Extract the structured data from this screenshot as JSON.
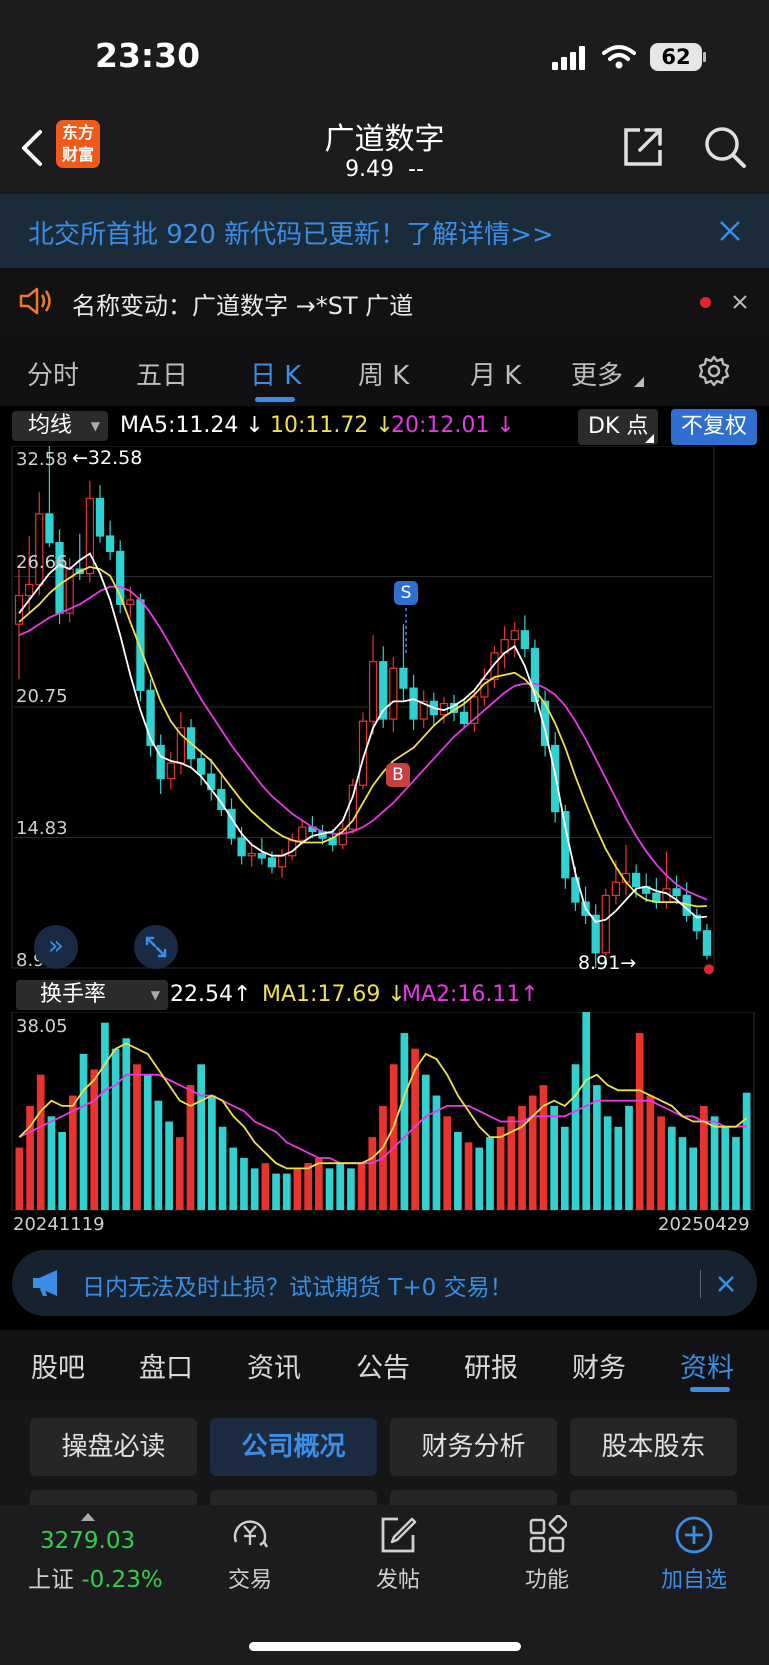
{
  "status": {
    "time": "23:30",
    "battery": "62"
  },
  "header": {
    "logo_line1": "东方",
    "logo_line2": "财富",
    "stock_name": "广道数字",
    "price": "9.49",
    "change": "--"
  },
  "banner": {
    "text": "北交所首批 920 新代码已更新！了解详情>>"
  },
  "notice": {
    "text": "名称变动：广道数字 →*ST 广道"
  },
  "tabs": [
    "分时",
    "五日",
    "日 K",
    "周 K",
    "月 K",
    "更多"
  ],
  "active_tab": "日 K",
  "indicator_bar": {
    "selector": "均线",
    "ma5": "MA5:11.24",
    "ma10": "10:11.72",
    "ma20": "20:12.01",
    "dk": "DK 点",
    "adjust": "不复权",
    "signal_s": "S",
    "signal_b": "B"
  },
  "sub_indicator": {
    "selector": "换手率",
    "value": "22.54",
    "ma1": "MA1:17.69",
    "ma2": "MA2:16.11"
  },
  "colors": {
    "up": "#e8332f",
    "down": "#2fd1d1",
    "ma5": "#ffffff",
    "ma10": "#f0e14b",
    "ma20": "#e63ae6",
    "accent": "#3a8ee6",
    "brand": "#f25a19"
  },
  "chart_data": [
    {
      "type": "candlestick",
      "y_axis_labels": [
        "32.58",
        "26.66",
        "20.75",
        "14.83",
        "8.91"
      ],
      "annotations": {
        "max": "←32.58",
        "min": "8.91→"
      },
      "ylim": [
        8.91,
        32.58
      ],
      "candles": [
        [
          24.5,
          27.0,
          22.0,
          25.8
        ],
        [
          25.8,
          28.5,
          25.0,
          26.3
        ],
        [
          26.3,
          30.5,
          25.8,
          29.5
        ],
        [
          29.5,
          32.58,
          28.0,
          28.2
        ],
        [
          28.2,
          28.8,
          24.5,
          25.0
        ],
        [
          25.0,
          27.5,
          24.6,
          27.0
        ],
        [
          27.0,
          28.6,
          26.5,
          26.8
        ],
        [
          26.8,
          31.0,
          26.4,
          30.2
        ],
        [
          30.2,
          30.8,
          28.2,
          28.5
        ],
        [
          28.5,
          29.2,
          27.4,
          27.8
        ],
        [
          27.8,
          28.3,
          25.0,
          25.4
        ],
        [
          25.4,
          26.2,
          24.8,
          25.6
        ],
        [
          25.6,
          25.9,
          21.0,
          21.5
        ],
        [
          21.5,
          22.0,
          18.5,
          19.0
        ],
        [
          19.0,
          19.5,
          16.8,
          17.5
        ],
        [
          17.5,
          18.7,
          17.0,
          18.2
        ],
        [
          18.2,
          20.5,
          17.7,
          19.8
        ],
        [
          19.8,
          20.2,
          18.0,
          18.4
        ],
        [
          18.4,
          18.8,
          17.2,
          17.7
        ],
        [
          17.7,
          18.4,
          16.5,
          17.0
        ],
        [
          17.0,
          17.6,
          15.8,
          16.1
        ],
        [
          16.1,
          16.6,
          14.5,
          14.8
        ],
        [
          14.8,
          15.3,
          13.6,
          14.0
        ],
        [
          14.0,
          14.6,
          13.5,
          14.1
        ],
        [
          14.1,
          14.8,
          13.6,
          13.9
        ],
        [
          13.9,
          14.2,
          13.2,
          13.5
        ],
        [
          13.5,
          14.3,
          13.0,
          14.0
        ],
        [
          14.0,
          15.0,
          13.8,
          14.7
        ],
        [
          14.7,
          15.6,
          14.5,
          15.3
        ],
        [
          15.3,
          15.8,
          14.8,
          15.1
        ],
        [
          15.1,
          15.4,
          14.5,
          14.8
        ],
        [
          14.8,
          15.2,
          14.2,
          14.5
        ],
        [
          14.5,
          15.5,
          14.3,
          15.2
        ],
        [
          15.2,
          17.5,
          15.0,
          17.2
        ],
        [
          17.2,
          20.5,
          17.0,
          20.1
        ],
        [
          20.1,
          24.0,
          19.5,
          22.8
        ],
        [
          22.8,
          23.5,
          19.8,
          20.2
        ],
        [
          20.2,
          23.0,
          19.6,
          22.5
        ],
        [
          22.5,
          24.5,
          21.0,
          21.6
        ],
        [
          21.6,
          22.2,
          19.7,
          20.2
        ],
        [
          20.2,
          21.5,
          19.8,
          21.0
        ],
        [
          21.0,
          21.4,
          19.9,
          20.4
        ],
        [
          20.4,
          21.2,
          20.0,
          20.9
        ],
        [
          20.9,
          21.3,
          20.1,
          20.5
        ],
        [
          20.5,
          21.1,
          19.8,
          20.0
        ],
        [
          20.0,
          21.5,
          19.6,
          21.2
        ],
        [
          21.2,
          22.5,
          20.8,
          22.0
        ],
        [
          22.0,
          23.5,
          21.6,
          23.2
        ],
        [
          23.2,
          24.4,
          22.5,
          23.8
        ],
        [
          23.8,
          24.6,
          23.0,
          24.2
        ],
        [
          24.2,
          24.9,
          23.0,
          23.4
        ],
        [
          23.4,
          23.8,
          20.5,
          21.0
        ],
        [
          21.0,
          21.5,
          18.5,
          19.0
        ],
        [
          19.0,
          19.6,
          15.5,
          16.0
        ],
        [
          16.0,
          16.3,
          12.5,
          13.0
        ],
        [
          13.0,
          13.5,
          11.5,
          11.9
        ],
        [
          11.9,
          12.6,
          10.9,
          11.3
        ],
        [
          11.3,
          11.8,
          8.91,
          9.6
        ],
        [
          9.6,
          12.5,
          9.4,
          12.2
        ],
        [
          12.2,
          13.8,
          11.8,
          12.8
        ],
        [
          12.8,
          14.5,
          12.2,
          13.2
        ],
        [
          13.2,
          13.6,
          12.1,
          12.6
        ],
        [
          12.6,
          13.2,
          11.9,
          12.3
        ],
        [
          12.3,
          13.0,
          11.6,
          11.9
        ],
        [
          11.9,
          14.2,
          11.6,
          12.5
        ],
        [
          12.5,
          13.1,
          11.8,
          12.2
        ],
        [
          12.2,
          12.8,
          11.0,
          11.3
        ],
        [
          11.3,
          11.6,
          10.2,
          10.6
        ],
        [
          10.6,
          10.9,
          9.3,
          9.49
        ]
      ],
      "ma5": [
        25.0,
        25.6,
        26.2,
        26.8,
        27.2,
        27.0,
        27.4,
        27.7,
        26.8,
        25.6,
        24.0,
        22.2,
        20.6,
        19.3,
        18.5,
        18.3,
        18.2,
        18.0,
        17.6,
        17.0,
        16.4,
        15.7,
        15.0,
        14.5,
        14.2,
        14.0,
        14.0,
        14.2,
        14.6,
        14.9,
        15.0,
        15.1,
        15.6,
        16.7,
        18.4,
        19.8,
        20.6,
        21.0,
        21.0,
        21.1,
        20.9,
        20.7,
        20.6,
        20.8,
        21.1,
        21.5,
        22.1,
        22.7,
        23.2,
        23.5,
        22.6,
        21.3,
        19.7,
        17.7,
        15.3,
        13.2,
        11.6,
        11.0,
        11.1,
        11.5,
        12.0,
        12.5,
        12.6,
        12.4,
        12.3,
        12.0,
        11.6,
        11.2,
        11.24
      ],
      "ma10": [
        24.6,
        25.0,
        25.4,
        25.9,
        26.3,
        26.6,
        26.9,
        27.1,
        27.0,
        26.7,
        25.8,
        24.6,
        23.4,
        22.2,
        21.0,
        20.1,
        19.5,
        19.1,
        18.7,
        18.3,
        17.7,
        17.1,
        16.5,
        16.0,
        15.6,
        15.2,
        14.9,
        14.7,
        14.6,
        14.6,
        14.6,
        14.8,
        15.1,
        15.6,
        16.4,
        17.2,
        17.8,
        18.3,
        18.6,
        18.9,
        19.4,
        19.9,
        20.3,
        20.6,
        20.9,
        21.3,
        21.8,
        22.1,
        22.2,
        22.3,
        22.0,
        21.5,
        20.9,
        20.0,
        18.9,
        17.6,
        16.4,
        15.3,
        14.3,
        13.5,
        12.8,
        12.3,
        12.0,
        11.9,
        11.9,
        11.9,
        11.8,
        11.7,
        11.72
      ],
      "ma20": [
        24.0,
        24.2,
        24.5,
        24.8,
        25.0,
        25.2,
        25.4,
        25.7,
        26.0,
        26.2,
        26.2,
        26.0,
        25.6,
        25.0,
        24.3,
        23.5,
        22.7,
        21.9,
        21.1,
        20.4,
        19.7,
        19.0,
        18.4,
        17.8,
        17.2,
        16.7,
        16.3,
        15.9,
        15.6,
        15.3,
        15.1,
        15.0,
        15.0,
        15.1,
        15.3,
        15.6,
        16.0,
        16.4,
        16.9,
        17.4,
        17.9,
        18.4,
        18.9,
        19.4,
        19.8,
        20.2,
        20.6,
        21.0,
        21.4,
        21.7,
        21.8,
        21.8,
        21.6,
        21.3,
        20.8,
        20.1,
        19.3,
        18.4,
        17.5,
        16.6,
        15.7,
        14.9,
        14.2,
        13.6,
        13.1,
        12.7,
        12.4,
        12.2,
        12.01
      ]
    },
    {
      "type": "bar",
      "title": "换手率",
      "y_axis_labels": [
        "38.05"
      ],
      "ylim": [
        0,
        38.05
      ],
      "x_labels": [
        "20241119",
        "20250429"
      ],
      "values": [
        12,
        20,
        26,
        18,
        15,
        22,
        30,
        27,
        36,
        31,
        33,
        28,
        26,
        21,
        17,
        14,
        24,
        28,
        22,
        16,
        12,
        10,
        8,
        9,
        7,
        7,
        8,
        9,
        10,
        8,
        9,
        8,
        9,
        14,
        20,
        28,
        34,
        31,
        26,
        22,
        18,
        15,
        13,
        12,
        14,
        16,
        18,
        20,
        22,
        24,
        20,
        16,
        28,
        38.05,
        24,
        18,
        16,
        20,
        34,
        22,
        18,
        16,
        14,
        12,
        20,
        18,
        16,
        14,
        22.54
      ],
      "ma1": [
        14,
        16,
        19,
        21,
        20,
        20,
        23,
        25,
        28,
        31,
        32,
        31,
        30,
        27,
        24,
        21,
        20,
        21,
        22,
        21,
        18,
        16,
        13,
        11,
        9,
        8,
        8,
        8,
        9,
        9,
        9,
        9,
        9,
        10,
        12,
        16,
        22,
        27,
        30,
        29,
        26,
        22,
        19,
        16,
        14,
        14,
        15,
        16,
        18,
        20,
        21,
        20,
        22,
        25,
        26,
        24,
        23,
        23,
        23,
        22,
        21,
        20,
        18,
        17,
        17,
        16,
        16,
        16,
        17.69
      ],
      "ma2": [
        14,
        15,
        16,
        17,
        18,
        19,
        20,
        21,
        23,
        24,
        26,
        26,
        26,
        26,
        25,
        24,
        23,
        22,
        22,
        21,
        20,
        19,
        17,
        16,
        15,
        13,
        12,
        11,
        10,
        10,
        9,
        9,
        9,
        9,
        10,
        12,
        14,
        16,
        18,
        19,
        20,
        20,
        20,
        19,
        18,
        17,
        17,
        17,
        18,
        18,
        18,
        18,
        19,
        20,
        21,
        21,
        21,
        21,
        21,
        21,
        20,
        19,
        18,
        18,
        17,
        17,
        16,
        16,
        16.11
      ]
    }
  ],
  "ad": {
    "text": "日内无法及时止损？试试期货 T+0 交易！"
  },
  "info_tabs": [
    "股吧",
    "盘口",
    "资讯",
    "公告",
    "研报",
    "财务",
    "资料"
  ],
  "active_info_tab": "资料",
  "sections": [
    "操盘必读",
    "公司概况",
    "财务分析",
    "股本股东"
  ],
  "active_section": "公司概况",
  "bottom": {
    "index_value": "3279.03",
    "index_name": "上证",
    "index_change": "-0.23%",
    "trade": "交易",
    "post": "发帖",
    "functions": "功能",
    "add_watch": "加自选"
  }
}
